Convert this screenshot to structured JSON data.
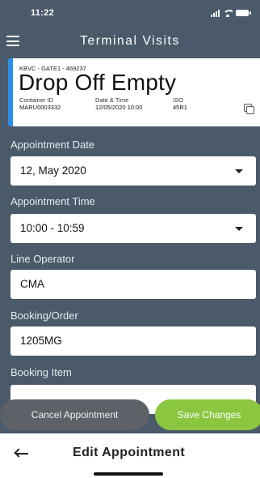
{
  "status_bar": {
    "time": "11:22",
    "icons": [
      "signal-icon",
      "wifi-icon",
      "battery-icon"
    ]
  },
  "header": {
    "title": "Terminal Visits",
    "menu_icon": "menu-icon"
  },
  "visit": {
    "meta": "KBVC - GATE1 - 469237",
    "type": "Drop Off Empty",
    "fields": [
      {
        "label": "Container ID",
        "value": "MARU0003332"
      },
      {
        "label": "Date & Time",
        "value": "12/05/2020 10:00"
      },
      {
        "label": "ISO",
        "value": "45R1"
      }
    ],
    "accent_color": "#2b8ee8",
    "copy_icon": "copy-icon"
  },
  "form": {
    "appointment_date": {
      "label": "Appointment Date",
      "value": "12, May 2020"
    },
    "appointment_time": {
      "label": "Appointment Time",
      "value": "10:00 - 10:59"
    },
    "line_operator": {
      "label": "Line Operator",
      "value": "CMA"
    },
    "booking_order": {
      "label": "Booking/Order",
      "value": "1205MG"
    },
    "booking_item": {
      "label": "Booking Item",
      "value": ""
    }
  },
  "actions": {
    "cancel_label": "Cancel Appointment",
    "save_label": "Save Changes",
    "cancel_color": "#5e6167",
    "save_color": "#8bc641"
  },
  "bottom_bar": {
    "title": "Edit Appointment",
    "back_icon": "back-arrow-icon"
  },
  "colors": {
    "background": "#4a5a6a"
  }
}
